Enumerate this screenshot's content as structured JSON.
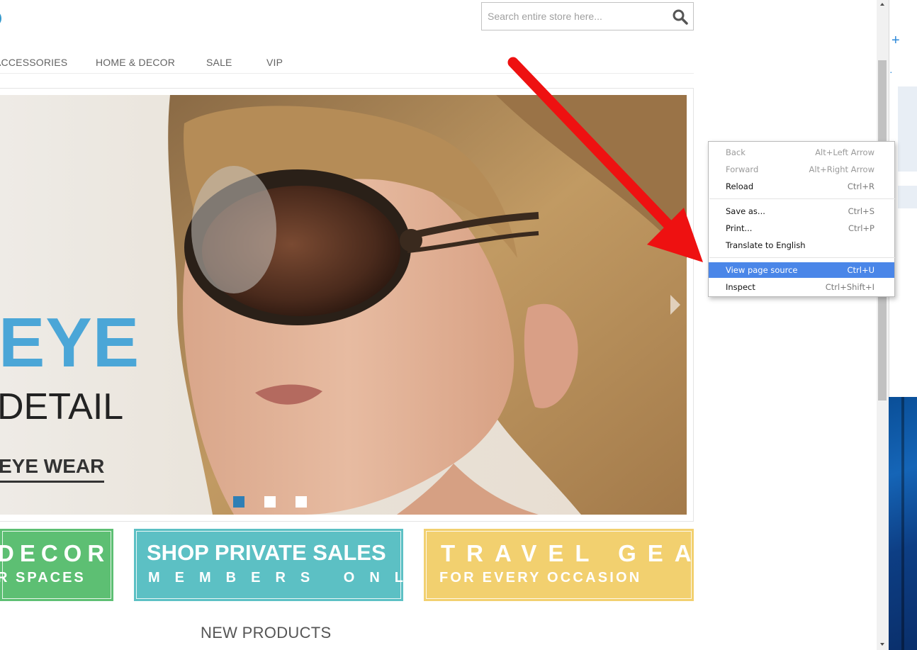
{
  "header": {
    "search_placeholder": "Search entire store here..."
  },
  "nav": {
    "items": [
      "ACCESSORIES",
      "HOME & DECOR",
      "SALE",
      "VIP"
    ]
  },
  "hero": {
    "headline": "EYE",
    "subheadline": "DETAIL",
    "link_text": "EYE WEAR",
    "slide_count": 3,
    "active_slide": 1
  },
  "promos": [
    {
      "line1": "DECOR",
      "line2": "R SPACES",
      "color": "#5dbf73"
    },
    {
      "line1": "SHOP PRIVATE SALES",
      "line2": "MEMBERS ONLY",
      "color": "#5cc0c4"
    },
    {
      "line1": "TRAVEL GEAR",
      "line2": "FOR EVERY OCCASION",
      "color": "#f2d06f"
    }
  ],
  "sections": {
    "new_products_title": "NEW PRODUCTS"
  },
  "context_menu": {
    "items": [
      {
        "label": "Back",
        "shortcut": "Alt+Left Arrow",
        "enabled": false
      },
      {
        "label": "Forward",
        "shortcut": "Alt+Right Arrow",
        "enabled": false
      },
      {
        "label": "Reload",
        "shortcut": "Ctrl+R",
        "enabled": true
      },
      {
        "label": "Save as...",
        "shortcut": "Ctrl+S",
        "enabled": true
      },
      {
        "label": "Print...",
        "shortcut": "Ctrl+P",
        "enabled": true
      },
      {
        "label": "Translate to English",
        "shortcut": "",
        "enabled": true
      },
      {
        "label": "View page source",
        "shortcut": "Ctrl+U",
        "enabled": true,
        "highlighted": true
      },
      {
        "label": "Inspect",
        "shortcut": "Ctrl+Shift+I",
        "enabled": true
      }
    ]
  },
  "icons": {
    "search": "search-icon",
    "scroll_up": "scroll-up-arrow-icon",
    "scroll_down": "scroll-down-arrow-icon",
    "annotation": "red-arrow-annotation-icon"
  },
  "colors": {
    "brand_blue": "#4ba6d7",
    "highlight": "#4a86e8",
    "annotation_red": "#ee1111",
    "slider_dot_active": "#2f7fb5"
  }
}
